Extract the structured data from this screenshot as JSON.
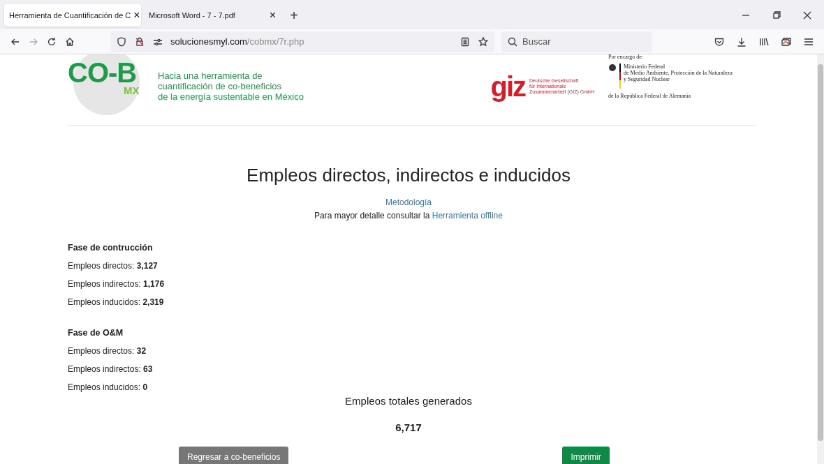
{
  "tabs": [
    {
      "label": "Herramienta de Cuantificación de C",
      "selected": true,
      "close": "×"
    },
    {
      "label": "Microsoft Word - 7 - 7.pdf",
      "selected": false,
      "close": "×"
    }
  ],
  "new_tab": "+",
  "address_bar": {
    "domain": "solucionesmyl.com",
    "path": "/cobmx/7r.php"
  },
  "search": {
    "placeholder": "Buscar"
  },
  "header": {
    "logo": {
      "main": "CO-B",
      "sub": "MX"
    },
    "tagline": [
      "Hacia una herramienta de",
      "cuantificación de co-beneficios",
      "de la energía sustentable en México"
    ],
    "giz": {
      "mark": "giz",
      "lines": [
        "Deutsche Gesellschaft",
        "für Internationale",
        "Zusammenarbeit (GIZ) GmbH"
      ]
    },
    "ministry": {
      "intro": "Por encargo de:",
      "lines": [
        "Ministerio Federal",
        "de Medio Ambiente, Protección de la Naturaleza",
        "y Seguridad Nuclear"
      ],
      "footer": "de la República Federal de Alemania"
    }
  },
  "title": "Empleos directos, indirectos e inducidos",
  "methodology_link": "Metodología",
  "detail_text": "Para mayor detalle consultar la",
  "detail_link": "Herramienta offline",
  "sections": [
    {
      "heading": "Fase de contrucción",
      "rows": [
        {
          "label": "Empleos directos:",
          "value": "3,127"
        },
        {
          "label": "Empleos indirectos:",
          "value": "1,176"
        },
        {
          "label": "Empleos inducidos:",
          "value": "2,319"
        }
      ]
    },
    {
      "heading": "Fase de O&M",
      "rows": [
        {
          "label": "Empleos directos:",
          "value": "32"
        },
        {
          "label": "Empleos indirectos:",
          "value": "63"
        },
        {
          "label": "Empleos inducidos:",
          "value": "0"
        }
      ]
    }
  ],
  "total": {
    "label": "Empleos totales generados",
    "value": "6,717"
  },
  "buttons": [
    {
      "label": "Regresar a co-beneficios",
      "kind": "secondary"
    },
    {
      "label": "Imprimir",
      "kind": "primary"
    }
  ]
}
